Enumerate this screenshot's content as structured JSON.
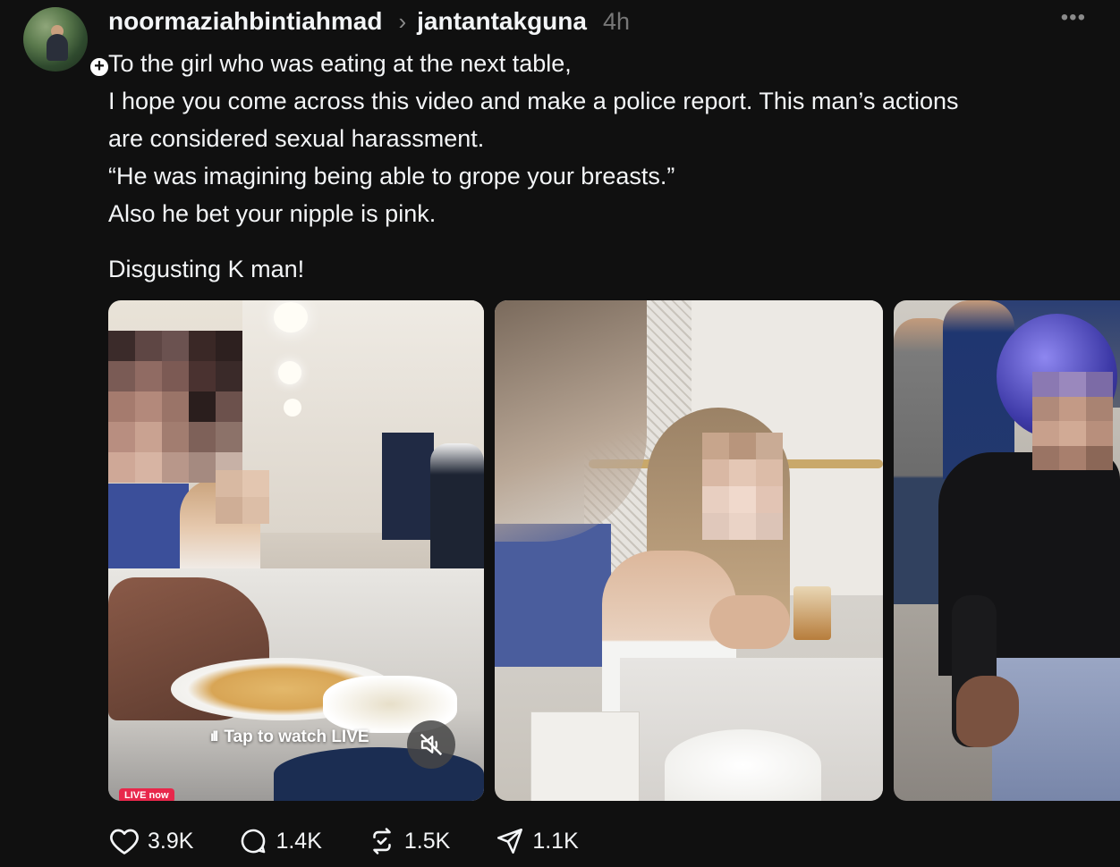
{
  "post": {
    "author": "noormaziahbintiahmad",
    "community": "jantantakguna",
    "time": "4h",
    "more_label": "•••",
    "lines": [
      "To the girl who was eating at the next table,",
      "I hope you come across this video and make a police report. This man’s actions",
      "are considered sexual harassment.",
      "“He was imagining being able to grope your breasts.”",
      "Also he bet your nipple is pink.",
      "Disgusting K man!"
    ]
  },
  "media": {
    "live_prompt": "Tap to watch LIVE",
    "live_badge": "LIVE now",
    "live_bars": "ıll"
  },
  "actions": {
    "likes": "3.9K",
    "replies": "1.4K",
    "reposts": "1.5K",
    "shares": "1.1K"
  },
  "icons": [
    "plus-icon",
    "chevron-right-icon",
    "more-icon",
    "mute-icon",
    "heart-icon",
    "comment-icon",
    "repost-icon",
    "share-icon"
  ]
}
